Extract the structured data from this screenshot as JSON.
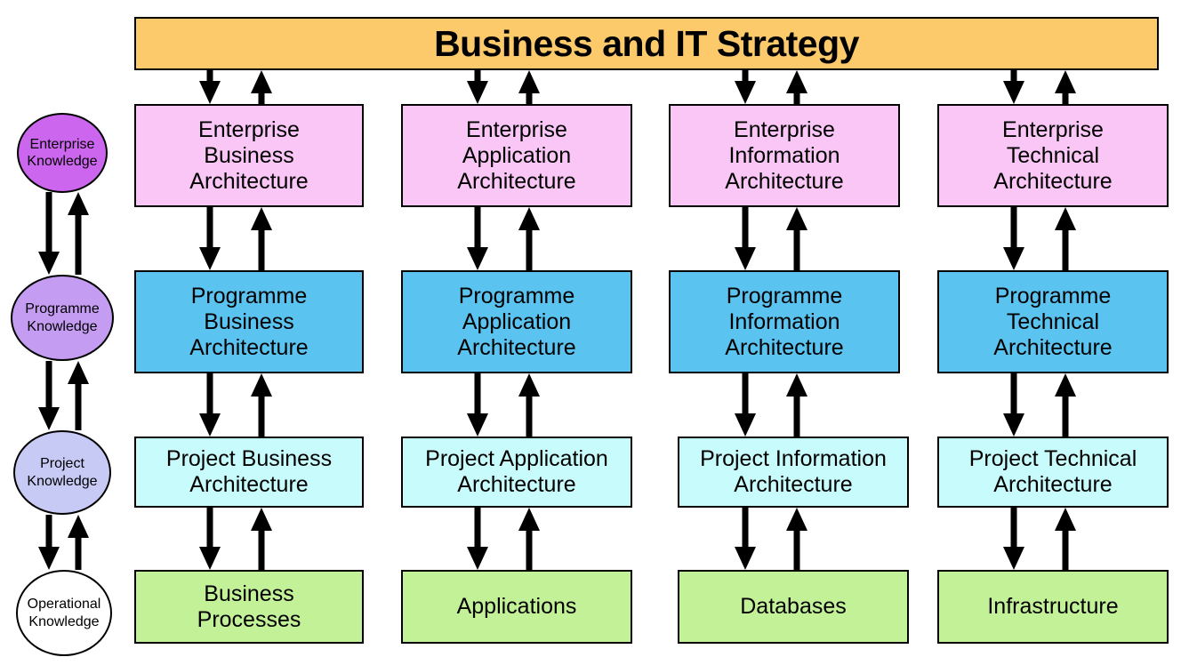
{
  "header": {
    "title": "Business and IT Strategy",
    "bg_color": "#fcc96b"
  },
  "knowledge_levels": [
    {
      "label": "Enterprise\nKnowledge",
      "line1": "Enterprise",
      "line2": "Knowledge",
      "color": "#cc66ee"
    },
    {
      "label": "Programme\nKnowledge",
      "line1": "Programme",
      "line2": "Knowledge",
      "color": "#c49cf2"
    },
    {
      "label": "Project\nKnowledge",
      "line1": "Project",
      "line2": "Knowledge",
      "color": "#c6caf5"
    },
    {
      "label": "Operational\nKnowledge",
      "line1": "Operational",
      "line2": "Knowledge",
      "color": "#ffffff"
    }
  ],
  "rows": [
    {
      "name": "enterprise",
      "color": "#f9c6f6",
      "cells": [
        {
          "line1": "Enterprise",
          "line2": "Business",
          "line3": "Architecture"
        },
        {
          "line1": "Enterprise",
          "line2": "Application",
          "line3": "Architecture"
        },
        {
          "line1": "Enterprise",
          "line2": "Information",
          "line3": "Architecture"
        },
        {
          "line1": "Enterprise",
          "line2": "Technical",
          "line3": "Architecture"
        }
      ]
    },
    {
      "name": "programme",
      "color": "#5ac3f0",
      "cells": [
        {
          "line1": "Programme",
          "line2": "Business",
          "line3": "Architecture"
        },
        {
          "line1": "Programme",
          "line2": "Application",
          "line3": "Architecture"
        },
        {
          "line1": "Programme",
          "line2": "Information",
          "line3": "Architecture"
        },
        {
          "line1": "Programme",
          "line2": "Technical",
          "line3": "Architecture"
        }
      ]
    },
    {
      "name": "project",
      "color": "#c8fbfb",
      "cells": [
        {
          "line1": "Project Business",
          "line2": "Architecture",
          "line3": ""
        },
        {
          "line1": "Project Application",
          "line2": "Architecture",
          "line3": ""
        },
        {
          "line1": "Project Information",
          "line2": "Architecture",
          "line3": ""
        },
        {
          "line1": "Project Technical",
          "line2": "Architecture",
          "line3": ""
        }
      ]
    },
    {
      "name": "operational",
      "color": "#c3f198",
      "cells": [
        {
          "line1": "Business",
          "line2": "Processes",
          "line3": ""
        },
        {
          "line1": "Applications",
          "line2": "",
          "line3": ""
        },
        {
          "line1": "Databases",
          "line2": "",
          "line3": ""
        },
        {
          "line1": "Infrastructure",
          "line2": "",
          "line3": ""
        }
      ]
    }
  ],
  "columns": [
    "Business",
    "Application",
    "Information",
    "Technical"
  ]
}
